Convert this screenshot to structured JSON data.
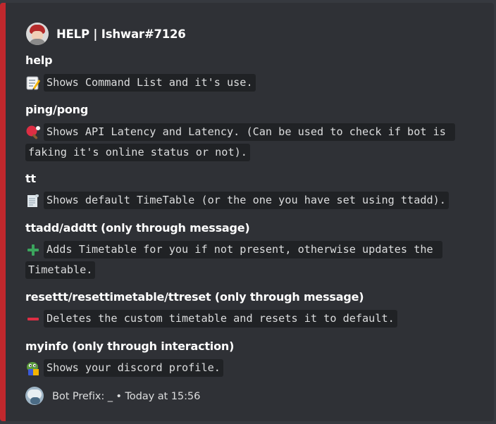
{
  "embed": {
    "accent_color": "#c0282d",
    "author": {
      "name": "HELP | Ishwar#7126",
      "avatar_icon": "user-avatar"
    },
    "fields": [
      {
        "name": "help",
        "icon": "memo-icon",
        "value_lines": [
          "Shows Command List and it's use."
        ]
      },
      {
        "name": "ping/pong",
        "icon": "ping-pong-icon",
        "value_lines": [
          "Shows API Latency and Latency. (Can be used to check if bot is ",
          "faking it's online status or not)."
        ]
      },
      {
        "name": "tt",
        "icon": "scroll-icon",
        "value_lines": [
          "Shows default TimeTable (or the one you have set using ttadd)."
        ]
      },
      {
        "name": "ttadd/addtt (only through message)",
        "icon": "plus-icon",
        "value_lines": [
          "Adds Timetable for you if not present, otherwise updates the ",
          "Timetable."
        ]
      },
      {
        "name": "resettt/resettimetable/ttreset (only through message)",
        "icon": "minus-icon",
        "value_lines": [
          "Deletes the custom timetable and resets it to default."
        ]
      },
      {
        "name": "myinfo (only through interaction)",
        "icon": "pepe-reading-icon",
        "value_lines": [
          "Shows your discord profile."
        ]
      }
    ],
    "footer": {
      "text": "Bot Prefix: _ • Today at 15:56",
      "icon": "bot-avatar"
    }
  }
}
